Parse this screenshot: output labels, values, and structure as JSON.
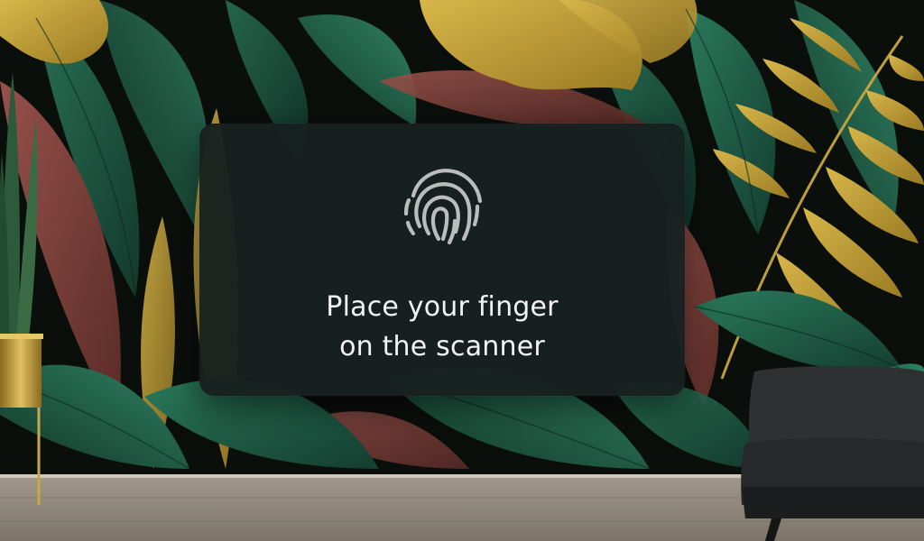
{
  "prompt": {
    "icon": "fingerprint-icon",
    "message": "Place your finger\non the scanner"
  },
  "colors": {
    "card_background": "#182120",
    "text": "#f2f4f3",
    "icon": "#b9bdbb",
    "leaf_green": "#1f5a45",
    "leaf_gold": "#c4a23a",
    "leaf_red": "#7d3f37",
    "floor": "#8f8576",
    "chair": "#2b2d2e"
  }
}
